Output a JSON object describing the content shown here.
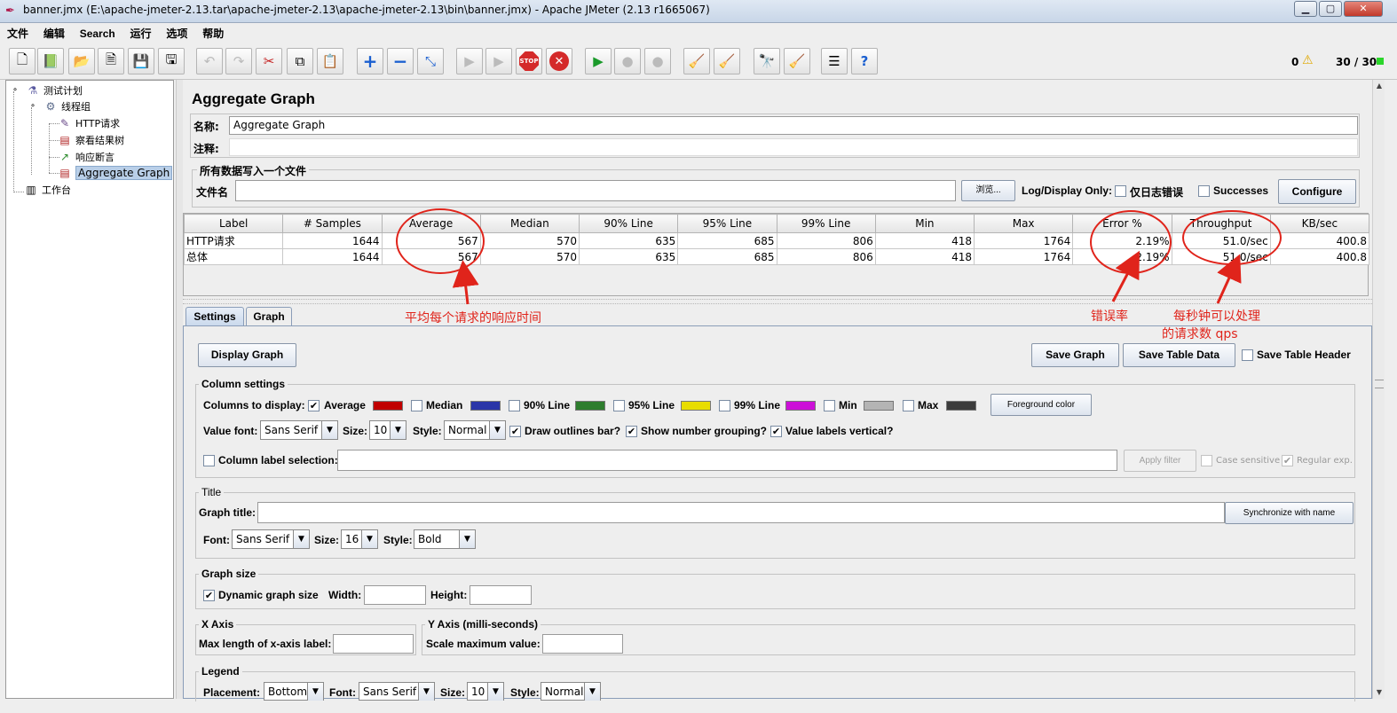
{
  "window": {
    "title": "banner.jmx (E:\\apache-jmeter-2.13.tar\\apache-jmeter-2.13\\apache-jmeter-2.13\\bin\\banner.jmx) - Apache JMeter (2.13 r1665067)",
    "minimize": "▁",
    "maximize": "▢",
    "close": "✕"
  },
  "menu": [
    "文件",
    "编辑",
    "Search",
    "运行",
    "选项",
    "帮助"
  ],
  "toolbar": {
    "icons": [
      "new-icon",
      "templates-icon",
      "open-icon",
      "close-icon",
      "save-icon",
      "save-as-icon",
      "undo-icon",
      "redo-icon",
      "cut-icon",
      "copy-icon",
      "paste-icon",
      "expand-icon",
      "collapse-icon",
      "toggle-icon",
      "start-icon",
      "start-no-pause-icon",
      "stop-icon",
      "shutdown-icon",
      "remote-start-icon",
      "remote-stop-icon",
      "remote-shutdown-icon",
      "clear-icon",
      "clear-all-icon",
      "search-icon",
      "reset-search-icon",
      "function-helper-icon",
      "help-icon"
    ],
    "warning_count": "0",
    "thread_count": "30 / 30"
  },
  "tree": {
    "test_plan": "测试计划",
    "thread_group": "线程组",
    "http_request": "HTTP请求",
    "view_results_tree": "察看结果树",
    "response_assertion": "响应断言",
    "aggregate_graph": "Aggregate Graph",
    "workbench": "工作台"
  },
  "panel": {
    "title": "Aggregate Graph",
    "name_label": "名称:",
    "name_value": "Aggregate Graph",
    "comment_label": "注释:",
    "comment_value": "",
    "file_section": "所有数据写入一个文件",
    "filename_label": "文件名",
    "filename_value": "",
    "browse_button": "浏览...",
    "log_display_label": "Log/Display Only:",
    "errors_only_label": "仅日志错误",
    "successes_label": "Successes",
    "configure_button": "Configure"
  },
  "table": {
    "columns": [
      "Label",
      "# Samples",
      "Average",
      "Median",
      "90% Line",
      "95% Line",
      "99% Line",
      "Min",
      "Max",
      "Error %",
      "Throughput",
      "KB/sec"
    ],
    "rows": [
      [
        "HTTP请求",
        "1644",
        "567",
        "570",
        "635",
        "685",
        "806",
        "418",
        "1764",
        "2.19%",
        "51.0/sec",
        "400.8"
      ],
      [
        "总体",
        "1644",
        "567",
        "570",
        "635",
        "685",
        "806",
        "418",
        "1764",
        "2.19%",
        "51.0/sec",
        "400.8"
      ]
    ]
  },
  "tabs": {
    "settings": "Settings",
    "graph": "Graph"
  },
  "settings": {
    "display_graph": "Display Graph",
    "save_graph": "Save Graph",
    "save_table_data": "Save Table Data",
    "save_table_header": "Save Table Header",
    "column_settings": "Column settings",
    "columns_to_display": "Columns to display:",
    "col_average": "Average",
    "col_median": "Median",
    "col_90": "90% Line",
    "col_95": "95% Line",
    "col_99": "99% Line",
    "col_min": "Min",
    "col_max": "Max",
    "colors": {
      "average": "#c00000",
      "median": "#2a35a8",
      "line90": "#2e7d2e",
      "line95": "#e8dd00",
      "line99": "#cc10d8",
      "min": "#b4b4b4",
      "max": "#3c3c3c"
    },
    "foreground_color": "Foreground color",
    "value_font_label": "Value font:",
    "value_font": "Sans Serif",
    "size_label": "Size:",
    "value_size": "10",
    "style_label": "Style:",
    "value_style": "Normal",
    "draw_outlines": "Draw outlines bar?",
    "number_grouping": "Show number grouping?",
    "labels_vertical": "Value labels vertical?",
    "column_label_selection": "Column label selection:",
    "apply_filter": "Apply filter",
    "case_sensitive": "Case sensitive",
    "regular_exp": "Regular exp.",
    "title_group": "Title",
    "graph_title_label": "Graph title:",
    "graph_title_value": "",
    "sync_name": "Synchronize with name",
    "font_label": "Font:",
    "title_font": "Sans Serif",
    "title_size": "16",
    "title_style": "Bold",
    "graph_size_group": "Graph size",
    "dynamic_size": "Dynamic graph size",
    "width_label": "Width:",
    "height_label": "Height:",
    "x_axis_group": "X Axis",
    "max_x_label": "Max length of x-axis label:",
    "y_axis_group": "Y Axis (milli-seconds)",
    "scale_max_label": "Scale maximum value:",
    "legend_group": "Legend",
    "placement_label": "Placement:",
    "placement": "Bottom",
    "legend_font": "Sans Serif",
    "legend_size": "10",
    "legend_style": "Normal"
  },
  "annotations": {
    "average": "平均每个请求的响应时间",
    "error": "错误率",
    "throughput_line1": "每秒钟可以处理",
    "throughput_line2": "的请求数 qps",
    "color": "#e0241b"
  }
}
